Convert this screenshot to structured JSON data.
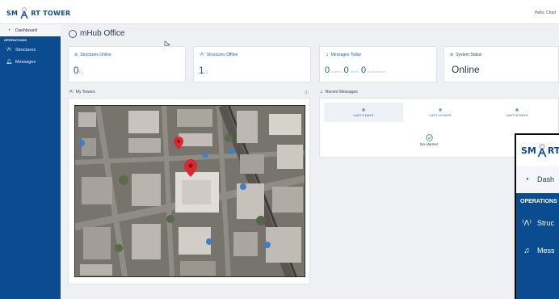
{
  "app": {
    "logo_left": "SM",
    "logo_right": "RT TOWER",
    "greeting": "Hello, Chad"
  },
  "sidebar": {
    "dashboard": "Dashboard",
    "section": "OPERATIONS",
    "structures": "Structures",
    "messages": "Messages"
  },
  "page": {
    "title": "mHub Office"
  },
  "stats": {
    "online": {
      "label": "Structures Online",
      "value": "0",
      "total": "/1"
    },
    "offline": {
      "label": "Structures Offline",
      "value": "1",
      "total": "/1"
    },
    "messages": {
      "label": "Messages Today",
      "alarms_value": "0",
      "alarms_label": "Alarms",
      "alerts_value": "0",
      "alerts_label": "Alerts",
      "notifications_value": "0",
      "notifications_label": "Notifications"
    },
    "system": {
      "label": "System Status",
      "value": "Online"
    }
  },
  "towers": {
    "heading": "My Towers"
  },
  "recent": {
    "heading": "Recent Messages",
    "periods": [
      "LAST 5 DAYS",
      "LAST 10 DAYS",
      "LAST 30 DAYS"
    ],
    "empty": "No Alarms!"
  },
  "popout": {
    "logo_left": "SM",
    "logo_right": "RT",
    "dashboard": "Dash",
    "section": "OPERATIONS",
    "structures": "Struc",
    "messages": "Mess"
  },
  "colors": {
    "brand": "#0b4b8f",
    "accent": "#1f5fa0",
    "ok": "#2e9e4f",
    "pin": "#d9282f"
  }
}
